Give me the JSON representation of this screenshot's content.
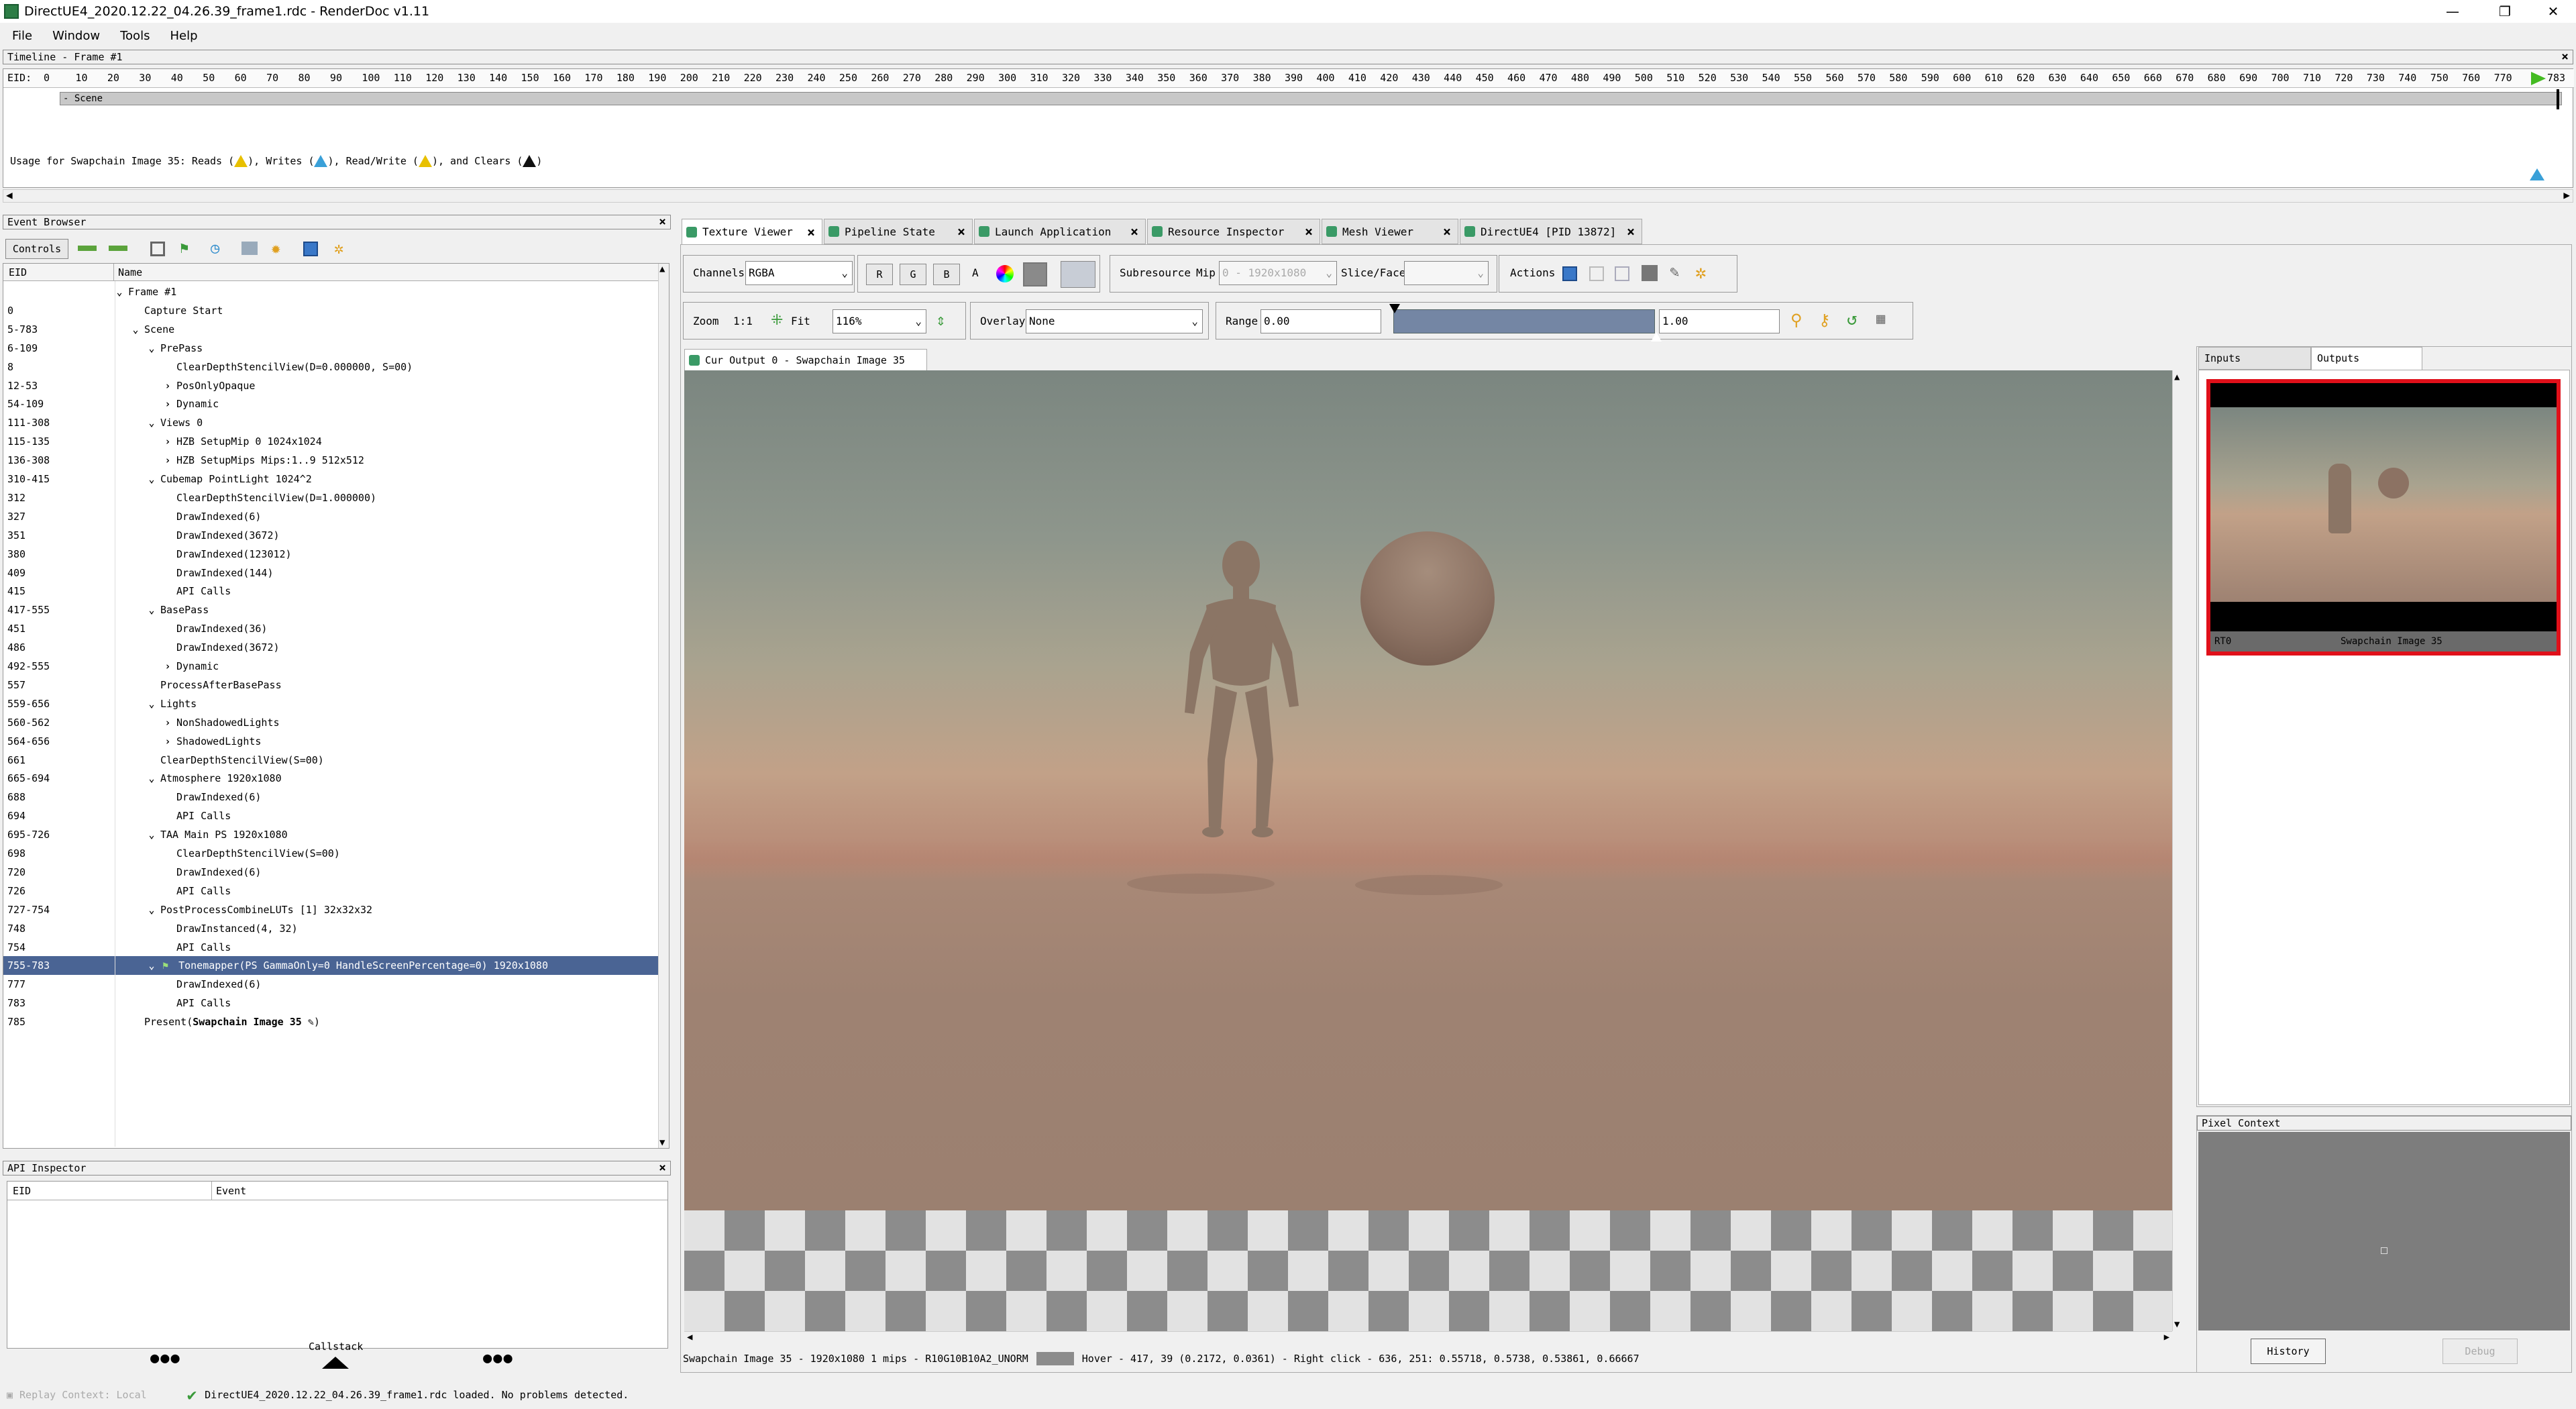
{
  "window": {
    "title": "DirectUE4_2020.12.22_04.26.39_frame1.rdc - RenderDoc v1.11",
    "minimize": "—",
    "restore": "❐",
    "close": "✕"
  },
  "menu": {
    "items": [
      "File",
      "Window",
      "Tools",
      "Help"
    ]
  },
  "timeline": {
    "header": "Timeline - Frame #1",
    "eid_label": "EID:",
    "ticks": [
      "0",
      "10",
      "20",
      "30",
      "40",
      "50",
      "60",
      "70",
      "80",
      "90",
      "100",
      "110",
      "120",
      "130",
      "140",
      "150",
      "160",
      "170",
      "180",
      "190",
      "200",
      "210",
      "220",
      "230",
      "240",
      "250",
      "260",
      "270",
      "280",
      "290",
      "300",
      "310",
      "320",
      "330",
      "340",
      "350",
      "360",
      "370",
      "380",
      "390",
      "400",
      "410",
      "420",
      "430",
      "440",
      "450",
      "460",
      "470",
      "480",
      "490",
      "500",
      "510",
      "520",
      "530",
      "540",
      "550",
      "560",
      "570",
      "580",
      "590",
      "600",
      "610",
      "620",
      "630",
      "640",
      "650",
      "660",
      "670",
      "680",
      "690",
      "700",
      "710",
      "720",
      "730",
      "740",
      "750",
      "760",
      "770"
    ],
    "end_tick": "783",
    "scene_label": "- Scene",
    "usage_prefix": "Usage for Swapchain Image 35: Reads (",
    "usage_writes": "), Writes (",
    "usage_rw": "), Read/Write (",
    "usage_clears": "), and Clears (",
    "usage_end": ")"
  },
  "event_browser": {
    "header": "Event Browser",
    "controls_label": "Controls",
    "col_eid": "EID",
    "col_name": "Name",
    "rows": [
      {
        "eid": "",
        "name": "Frame #1",
        "indent": 0,
        "chev": "v"
      },
      {
        "eid": "0",
        "name": "Capture Start",
        "indent": 1,
        "chev": ""
      },
      {
        "eid": "5-783",
        "name": "Scene",
        "indent": 1,
        "chev": "v"
      },
      {
        "eid": "6-109",
        "name": "PrePass",
        "indent": 2,
        "chev": "v"
      },
      {
        "eid": "8",
        "name": "ClearDepthStencilView(D=0.000000, S=00)",
        "indent": 3,
        "chev": ""
      },
      {
        "eid": "12-53",
        "name": "PosOnlyOpaque",
        "indent": 3,
        "chev": ">"
      },
      {
        "eid": "54-109",
        "name": "Dynamic",
        "indent": 3,
        "chev": ">"
      },
      {
        "eid": "111-308",
        "name": "Views 0",
        "indent": 2,
        "chev": "v"
      },
      {
        "eid": "115-135",
        "name": "HZB SetupMip 0 1024x1024",
        "indent": 3,
        "chev": ">"
      },
      {
        "eid": "136-308",
        "name": "HZB SetupMips Mips:1..9 512x512",
        "indent": 3,
        "chev": ">"
      },
      {
        "eid": "310-415",
        "name": "Cubemap PointLight 1024^2",
        "indent": 2,
        "chev": "v"
      },
      {
        "eid": "312",
        "name": "ClearDepthStencilView(D=1.000000)",
        "indent": 3,
        "chev": ""
      },
      {
        "eid": "327",
        "name": "DrawIndexed(6)",
        "indent": 3,
        "chev": ""
      },
      {
        "eid": "351",
        "name": "DrawIndexed(3672)",
        "indent": 3,
        "chev": ""
      },
      {
        "eid": "380",
        "name": "DrawIndexed(123012)",
        "indent": 3,
        "chev": ""
      },
      {
        "eid": "409",
        "name": "DrawIndexed(144)",
        "indent": 3,
        "chev": ""
      },
      {
        "eid": "415",
        "name": "API Calls",
        "indent": 3,
        "chev": ""
      },
      {
        "eid": "417-555",
        "name": "BasePass",
        "indent": 2,
        "chev": "v"
      },
      {
        "eid": "451",
        "name": "DrawIndexed(36)",
        "indent": 3,
        "chev": ""
      },
      {
        "eid": "486",
        "name": "DrawIndexed(3672)",
        "indent": 3,
        "chev": ""
      },
      {
        "eid": "492-555",
        "name": "Dynamic",
        "indent": 3,
        "chev": ">"
      },
      {
        "eid": "557",
        "name": "ProcessAfterBasePass",
        "indent": 2,
        "chev": ""
      },
      {
        "eid": "559-656",
        "name": "Lights",
        "indent": 2,
        "chev": "v"
      },
      {
        "eid": "560-562",
        "name": "NonShadowedLights",
        "indent": 3,
        "chev": ">"
      },
      {
        "eid": "564-656",
        "name": "ShadowedLights",
        "indent": 3,
        "chev": ">"
      },
      {
        "eid": "661",
        "name": "ClearDepthStencilView(S=00)",
        "indent": 2,
        "chev": ""
      },
      {
        "eid": "665-694",
        "name": "Atmosphere 1920x1080",
        "indent": 2,
        "chev": "v"
      },
      {
        "eid": "688",
        "name": "DrawIndexed(6)",
        "indent": 3,
        "chev": ""
      },
      {
        "eid": "694",
        "name": "API Calls",
        "indent": 3,
        "chev": ""
      },
      {
        "eid": "695-726",
        "name": "TAA Main PS 1920x1080",
        "indent": 2,
        "chev": "v"
      },
      {
        "eid": "698",
        "name": "ClearDepthStencilView(S=00)",
        "indent": 3,
        "chev": ""
      },
      {
        "eid": "720",
        "name": "DrawIndexed(6)",
        "indent": 3,
        "chev": ""
      },
      {
        "eid": "726",
        "name": "API Calls",
        "indent": 3,
        "chev": ""
      },
      {
        "eid": "727-754",
        "name": "PostProcessCombineLUTs [1] 32x32x32",
        "indent": 2,
        "chev": "v"
      },
      {
        "eid": "748",
        "name": "DrawInstanced(4, 32)",
        "indent": 3,
        "chev": ""
      },
      {
        "eid": "754",
        "name": "API Calls",
        "indent": 3,
        "chev": ""
      },
      {
        "eid": "755-783",
        "name": "Tonemapper(PS GammaOnly=0 HandleScreenPercentage=0) 1920x1080",
        "indent": 2,
        "chev": "v",
        "selected": true
      },
      {
        "eid": "777",
        "name": "DrawIndexed(6)",
        "indent": 3,
        "chev": ""
      },
      {
        "eid": "783",
        "name": "API Calls",
        "indent": 3,
        "chev": ""
      },
      {
        "eid": "785",
        "name": "Present(",
        "bold": "Swapchain Image 35",
        "suffix": ")",
        "indent": 1,
        "chev": ""
      }
    ]
  },
  "api_inspector": {
    "header": "API Inspector",
    "col_eid": "EID",
    "col_event": "Event",
    "callstack": "Callstack",
    "dots": "●●●"
  },
  "tabs": [
    {
      "label": "Texture Viewer",
      "active": true
    },
    {
      "label": "Pipeline State"
    },
    {
      "label": "Launch Application"
    },
    {
      "label": "Resource Inspector"
    },
    {
      "label": "Mesh Viewer"
    },
    {
      "label": "DirectUE4 [PID 13872]"
    }
  ],
  "toolbar": {
    "channels_label": "Channels",
    "channels_value": "RGBA",
    "r": "R",
    "g": "G",
    "b": "B",
    "a": "A",
    "subresource_label": "Subresource",
    "mip_label": "Mip",
    "mip_value": "0 - 1920x1080",
    "slice_label": "Slice/Face",
    "actions_label": "Actions",
    "zoom_label": "Zoom",
    "zoom_1to1": "1:1",
    "fit_label": "Fit",
    "zoom_value": "116%",
    "overlay_label": "Overlay",
    "overlay_value": "None",
    "range_label": "Range",
    "range_min": "0.00",
    "range_max": "1.00"
  },
  "subtab": {
    "label": "Cur Output 0 - Swapchain Image 35"
  },
  "status_line": {
    "info": "Swapchain Image 35 - 1920x1080 1 mips - R10G10B10A2_UNORM",
    "hover": "Hover -   417,   39 (0.2172, 0.0361)  - Right click -   636,  251: 0.55718, 0.5738, 0.53861, 0.66667"
  },
  "thumbnails": {
    "inputs_tab": "Inputs",
    "outputs_tab": "Outputs",
    "rt_label": "RT0",
    "image_label": "Swapchain Image 35",
    "highlight_color": "#e0101a"
  },
  "pixel_context": {
    "header": "Pixel Context",
    "history": "History",
    "debug": "Debug"
  },
  "statusbar": {
    "replay_context": "Replay Context: Local",
    "message": "DirectUE4_2020.12.22_04.26.39_frame1.rdc loaded. No problems detected."
  },
  "colors": {
    "selection": "#4a6494",
    "accent_green": "#3a9a66",
    "range_bar": "#7486a4"
  }
}
